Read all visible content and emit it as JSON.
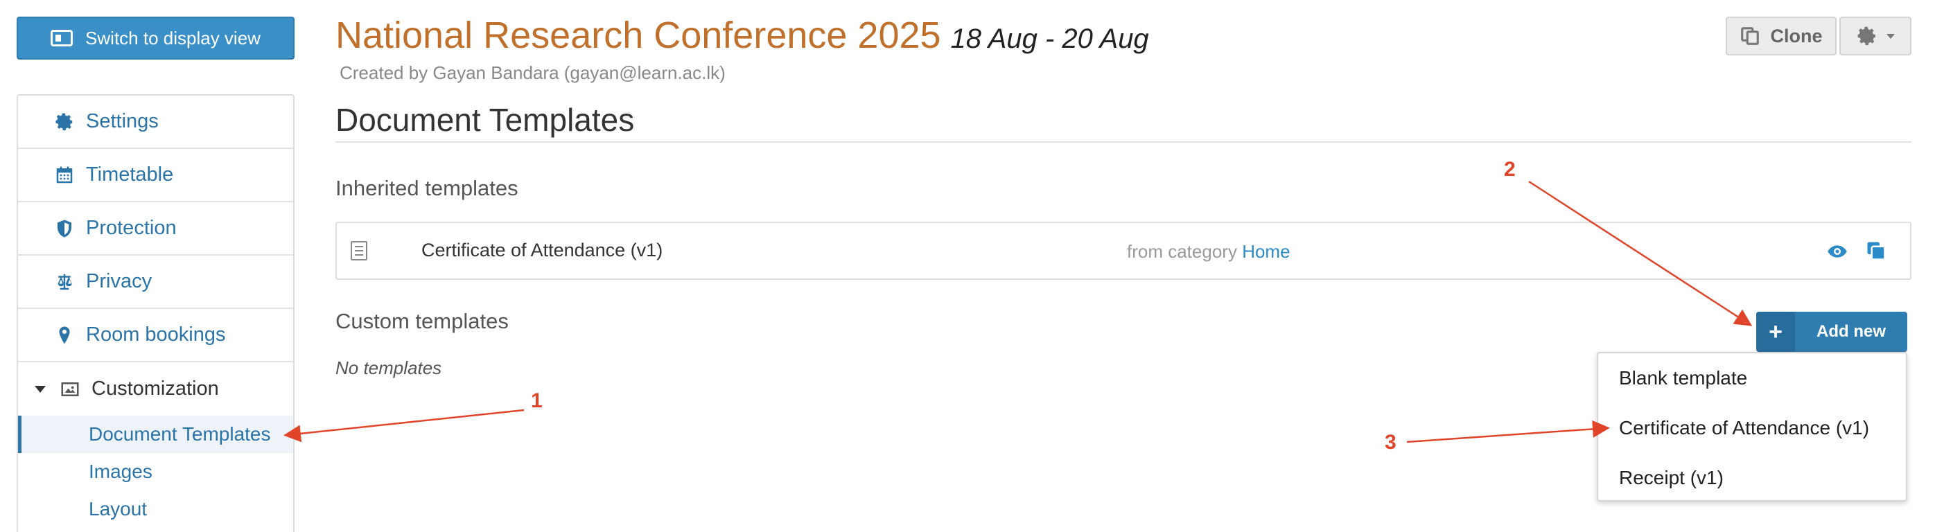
{
  "switch_view": {
    "label": "Switch to display view",
    "icon": "display-icon"
  },
  "sidebar": {
    "items": [
      {
        "label": "Settings",
        "icon": "gear-icon"
      },
      {
        "label": "Timetable",
        "icon": "calendar-icon"
      },
      {
        "label": "Protection",
        "icon": "shield-icon"
      },
      {
        "label": "Privacy",
        "icon": "scales-icon"
      },
      {
        "label": "Room bookings",
        "icon": "map-pin-icon"
      }
    ],
    "customization": {
      "label": "Customization",
      "icon": "image-icon"
    },
    "sub_items": [
      {
        "label": "Document Templates",
        "active": true
      },
      {
        "label": "Images"
      },
      {
        "label": "Layout"
      }
    ]
  },
  "event": {
    "title": "National Research Conference 2025",
    "dates": "18 Aug - 20 Aug",
    "created_by": "Created by Gayan Bandara (gayan@learn.ac.lk)"
  },
  "toolbar": {
    "clone_label": "Clone",
    "settings_icon": "gear-icon"
  },
  "page": {
    "title": "Document Templates",
    "inherited_heading": "Inherited templates",
    "inherited": [
      {
        "name": "Certificate of Attendance (v1)",
        "from_prefix": "from category",
        "category": "Home"
      }
    ],
    "custom_heading": "Custom templates",
    "no_templates": "No templates",
    "add_new_label": "Add new"
  },
  "dropdown": {
    "items": [
      "Blank template",
      "Certificate of Attendance (v1)",
      "Receipt (v1)"
    ]
  },
  "annotations": {
    "one": "1",
    "two": "2",
    "three": "3"
  },
  "colors": {
    "accent": "#2a74a8",
    "title": "#c0702a",
    "annotation": "#e0452a"
  }
}
